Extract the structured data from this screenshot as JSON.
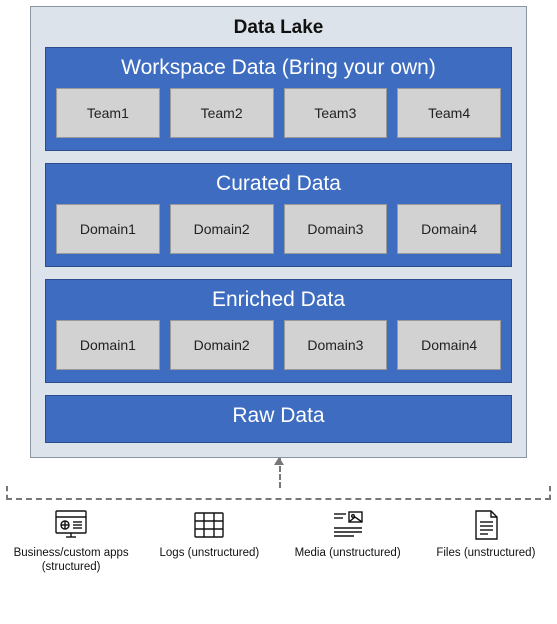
{
  "lake": {
    "title": "Data Lake",
    "zones": [
      {
        "title": "Workspace Data (Bring your own)",
        "boxes": [
          "Team1",
          "Team2",
          "Team3",
          "Team4"
        ]
      },
      {
        "title": "Curated Data",
        "boxes": [
          "Domain1",
          "Domain2",
          "Domain3",
          "Domain4"
        ]
      },
      {
        "title": "Enriched Data",
        "boxes": [
          "Domain1",
          "Domain2",
          "Domain3",
          "Domain4"
        ]
      },
      {
        "title": "Raw Data",
        "boxes": []
      }
    ]
  },
  "sources": [
    {
      "icon": "apps-icon",
      "label": "Business/custom apps (structured)"
    },
    {
      "icon": "logs-icon",
      "label": "Logs (unstructured)"
    },
    {
      "icon": "media-icon",
      "label": "Media (unstructured)"
    },
    {
      "icon": "files-icon",
      "label": "Files (unstructured)"
    }
  ]
}
